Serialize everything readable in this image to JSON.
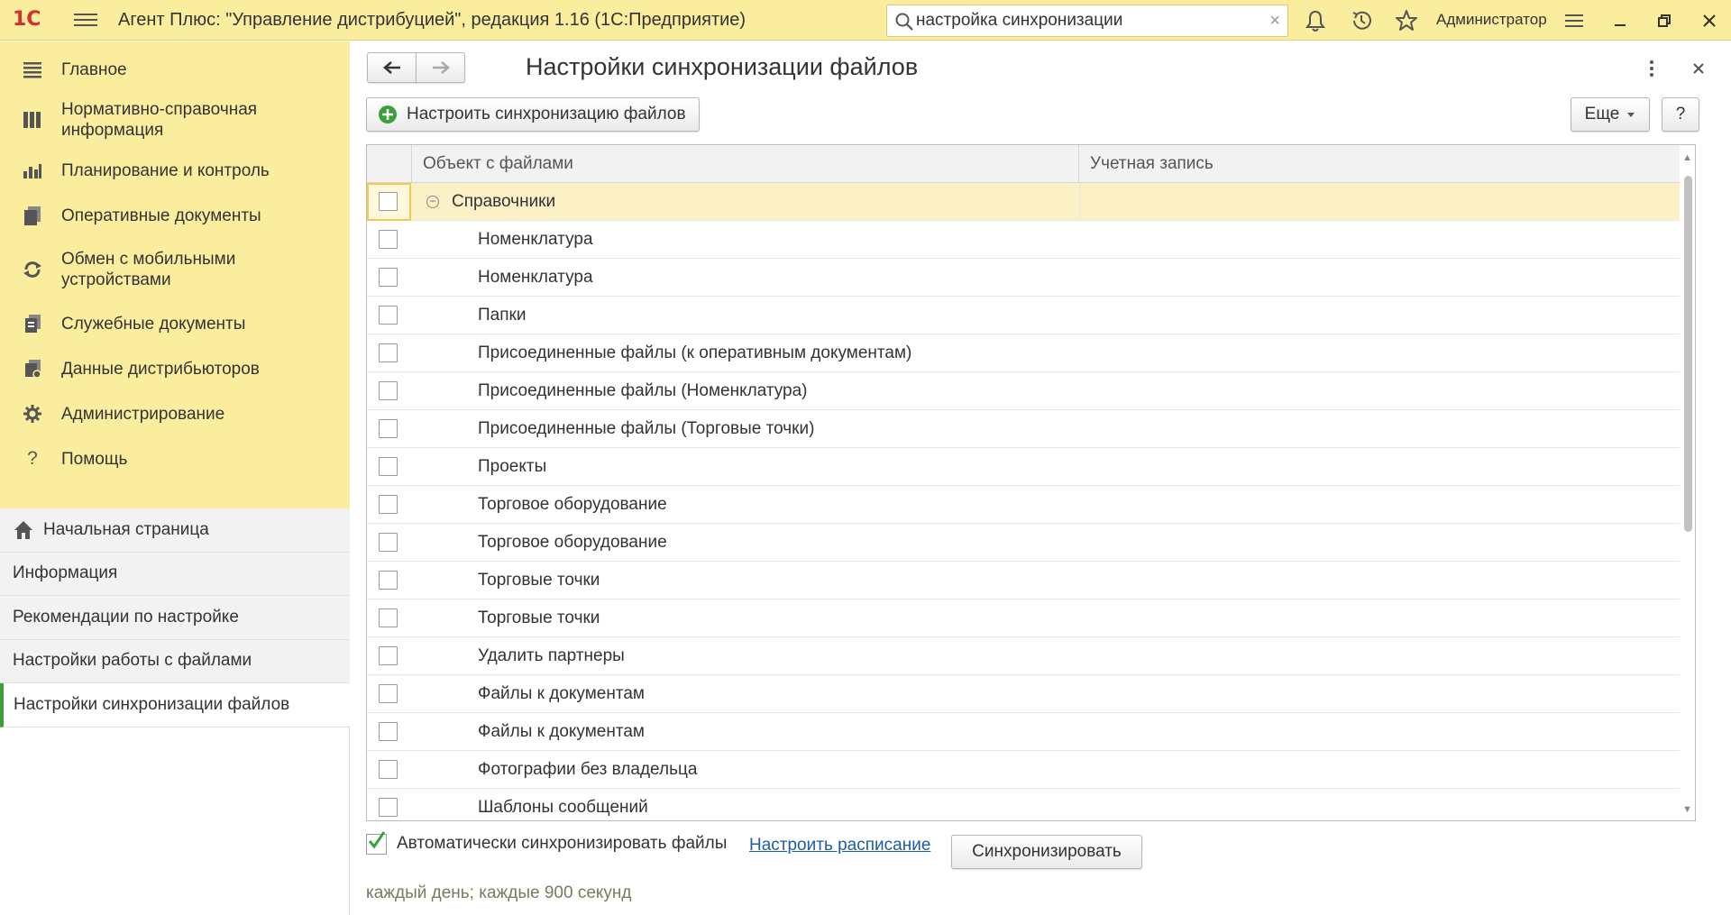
{
  "app": {
    "logo_text": "1С",
    "title": "Агент Плюс: \"Управление дистрибуцией\", редакция 1.16  (1С:Предприятие)",
    "user": "Администратор"
  },
  "search": {
    "value": "настройка синхронизации",
    "clear_glyph": "×"
  },
  "sidebar": {
    "sections": [
      {
        "label": "Главное",
        "icon": "menu-lines-icon"
      },
      {
        "label": "Нормативно-справочная информация",
        "icon": "book-icon"
      },
      {
        "label": "Планирование и контроль",
        "icon": "bar-chart-icon"
      },
      {
        "label": "Оперативные документы",
        "icon": "documents-icon"
      },
      {
        "label": "Обмен с мобильными устройствами",
        "icon": "sync-icon"
      },
      {
        "label": "Служебные документы",
        "icon": "service-docs-icon"
      },
      {
        "label": "Данные дистрибьюторов",
        "icon": "distributor-data-icon"
      },
      {
        "label": "Администрирование",
        "icon": "gear-icon"
      },
      {
        "label": "Помощь",
        "icon": "help-icon",
        "glyph": "?"
      }
    ],
    "open_items": [
      {
        "label": "Начальная страница",
        "icon": "home-icon"
      },
      {
        "label": "Информация"
      },
      {
        "label": "Рекомендации по настройке"
      },
      {
        "label": "Настройки работы с файлами"
      },
      {
        "label": "Настройки синхронизации файлов",
        "active": true
      }
    ]
  },
  "form": {
    "title": "Настройки синхронизации файлов",
    "setup_button": "Настроить синхронизацию файлов",
    "more_button": "Еще",
    "help_button": "?",
    "columns": [
      "Объект с файлами",
      "Учетная запись"
    ],
    "group": "Справочники",
    "rows": [
      "Номенклатура",
      "Номенклатура",
      "Папки",
      "Присоединенные файлы (к оперативным документам)",
      "Присоединенные файлы (Номенклатура)",
      "Присоединенные файлы (Торговые точки)",
      "Проекты",
      "Торговое оборудование",
      "Торговое оборудование",
      "Торговые точки",
      "Торговые точки",
      "Удалить партнеры",
      "Файлы к документам",
      "Файлы к документам",
      "Фотографии без владельца",
      "Шаблоны сообщений"
    ],
    "auto_sync_label": "Автоматически синхронизировать файлы",
    "auto_sync_checked": true,
    "schedule_link": "Настроить расписание",
    "sync_button": "Синхронизировать",
    "schedule_text": "каждый день; каждые 900 секунд"
  },
  "colors": {
    "accent_bar": "#fbed9e",
    "active_marker": "#3aa13a",
    "link": "#1c5dab",
    "logo": "#d0302f"
  }
}
